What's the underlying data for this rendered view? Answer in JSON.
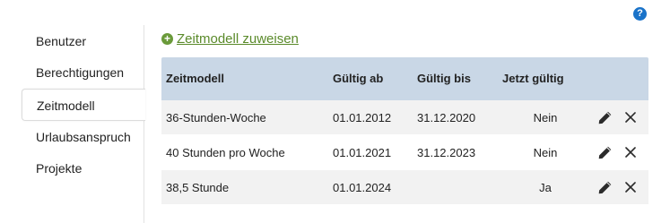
{
  "help": {
    "label": "?"
  },
  "sidebar": {
    "items": [
      {
        "label": "Benutzer",
        "active": false
      },
      {
        "label": "Berechtigungen",
        "active": false
      },
      {
        "label": "Zeitmodell",
        "active": true
      },
      {
        "label": "Urlaubsanspruch",
        "active": false
      },
      {
        "label": "Projekte",
        "active": false
      }
    ]
  },
  "assign": {
    "icon": "plus-circle-icon",
    "label": "Zeitmodell zuweisen"
  },
  "table": {
    "headers": {
      "model": "Zeitmodell",
      "from": "Gültig ab",
      "to": "Gültig bis",
      "now": "Jetzt gültig"
    },
    "rows": [
      {
        "model": "36-Stunden-Woche",
        "from": "01.01.2012",
        "to": "31.12.2020",
        "now": "Nein"
      },
      {
        "model": "40 Stunden pro Woche",
        "from": "01.01.2021",
        "to": "31.12.2023",
        "now": "Nein"
      },
      {
        "model": "38,5 Stunde",
        "from": "01.01.2024",
        "to": "",
        "now": "Ja"
      }
    ]
  },
  "colors": {
    "header_bg": "#c9d7e6",
    "link_green": "#5a8a2a",
    "help_blue": "#1a73c9"
  }
}
